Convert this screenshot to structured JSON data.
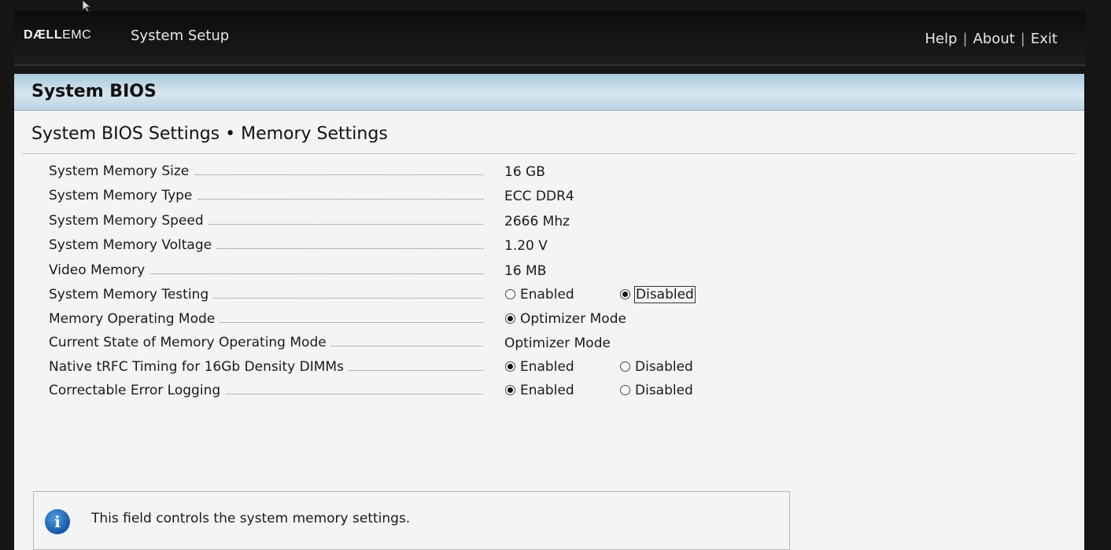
{
  "header": {
    "brand_dell": "DÆLL",
    "brand_emc": "EMC",
    "app_title": "System Setup",
    "links": [
      "Help",
      "About",
      "Exit"
    ],
    "separator": "|"
  },
  "page": {
    "title": "System BIOS",
    "section_title": "System BIOS Settings • Memory Settings"
  },
  "settings": [
    {
      "label": "System Memory Size",
      "value": "16 GB"
    },
    {
      "label": "System Memory Type",
      "value": "ECC DDR4"
    },
    {
      "label": "System Memory Speed",
      "value": "2666 Mhz"
    },
    {
      "label": "System Memory Voltage",
      "value": "1.20 V"
    },
    {
      "label": "Video Memory",
      "value": "16 MB"
    },
    {
      "label": "System Memory Testing",
      "options": [
        "Enabled",
        "Disabled"
      ],
      "selected": "Disabled"
    },
    {
      "label": "Memory Operating Mode",
      "options": [
        "Optimizer Mode"
      ],
      "selected": "Optimizer Mode"
    },
    {
      "label": "Current State of Memory Operating Mode",
      "value": "Optimizer Mode"
    },
    {
      "label": "Native tRFC Timing for 16Gb Density DIMMs",
      "options": [
        "Enabled",
        "Disabled"
      ],
      "selected": "Enabled"
    },
    {
      "label": "Correctable Error Logging",
      "options": [
        "Enabled",
        "Disabled"
      ],
      "selected": "Enabled"
    }
  ],
  "help": {
    "icon": "info-icon",
    "icon_glyph": "i",
    "text": "This field controls the system memory settings."
  },
  "colors": {
    "header_bar": "#0c0c0c",
    "title_band": "#c8dcea",
    "panel": "#f4f4f4",
    "info_icon": "#1f66b8"
  }
}
